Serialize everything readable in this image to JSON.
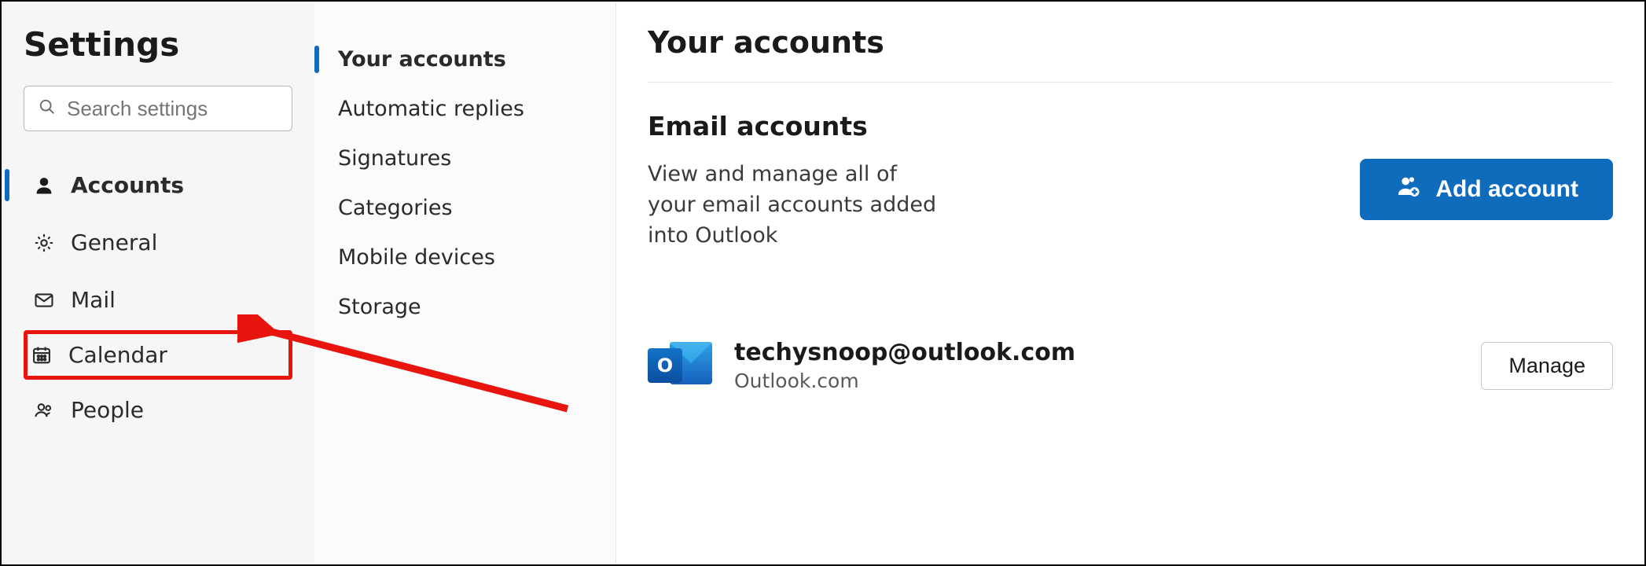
{
  "left": {
    "title": "Settings",
    "search_placeholder": "Search settings",
    "nav": [
      {
        "label": "Accounts",
        "icon": "person",
        "active": true
      },
      {
        "label": "General",
        "icon": "gear"
      },
      {
        "label": "Mail",
        "icon": "mail"
      },
      {
        "label": "Calendar",
        "icon": "calendar",
        "highlighted": true
      },
      {
        "label": "People",
        "icon": "people"
      }
    ]
  },
  "mid": {
    "items": [
      {
        "label": "Your accounts",
        "active": true
      },
      {
        "label": "Automatic replies"
      },
      {
        "label": "Signatures"
      },
      {
        "label": "Categories"
      },
      {
        "label": "Mobile devices"
      },
      {
        "label": "Storage"
      }
    ]
  },
  "right": {
    "page_title": "Your accounts",
    "email_section_title": "Email accounts",
    "email_section_desc": "View and manage all of your email accounts added into Outlook",
    "add_account_label": "Add account",
    "account": {
      "email": "techysnoop@outlook.com",
      "provider": "Outlook.com",
      "logo_letter": "O"
    },
    "manage_label": "Manage"
  }
}
